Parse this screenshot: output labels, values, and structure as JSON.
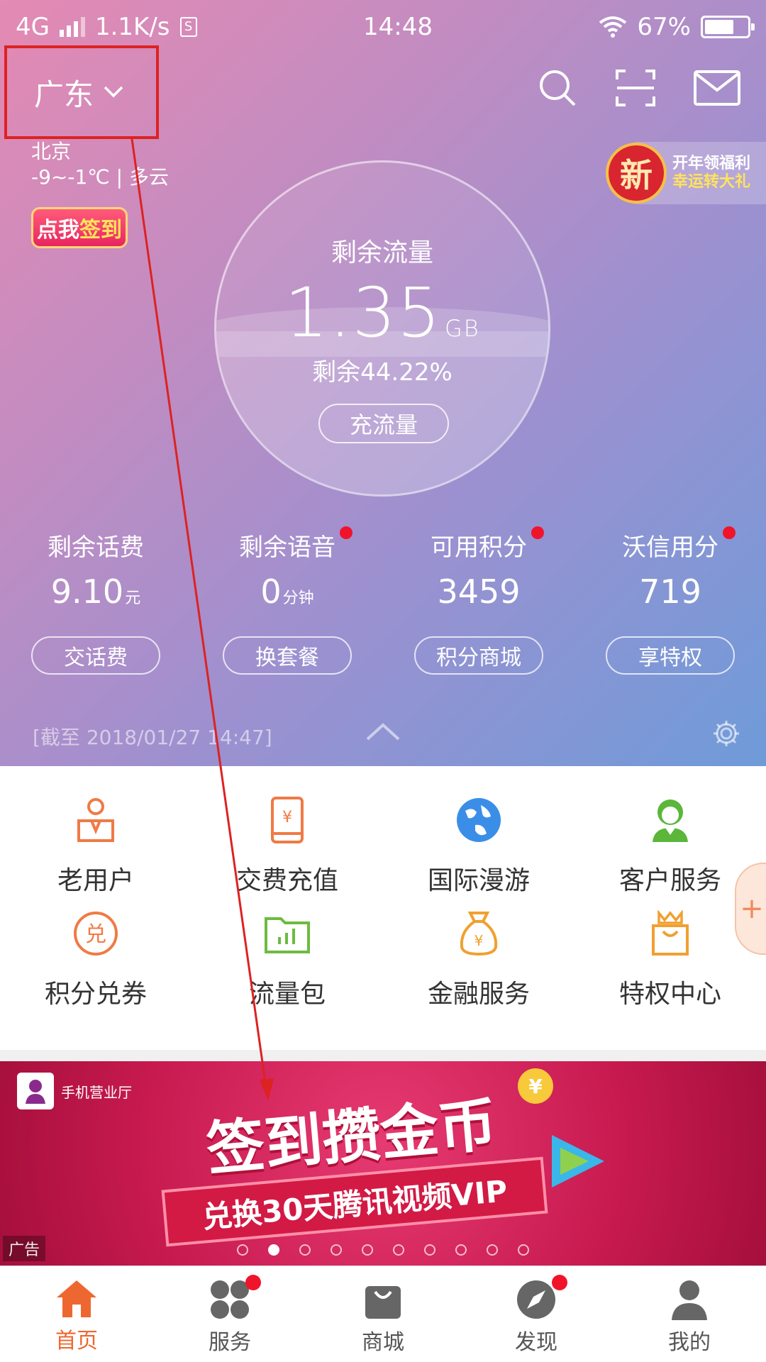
{
  "status_bar": {
    "network": "4G",
    "speed": "1.1K/s",
    "time": "14:48",
    "battery": "67%"
  },
  "header": {
    "region": "广东",
    "city": "北京",
    "weather": "-9~-1℃ | 多云",
    "signin_part1": "点我",
    "signin_part2": "签到",
    "promo_badge": "新",
    "promo_line1": "开年领福利",
    "promo_line2": "幸运转大礼"
  },
  "gauge": {
    "title": "剩余流量",
    "value": "1.35",
    "unit": "GB",
    "percent": "剩余44.22%",
    "button": "充流量"
  },
  "stats": [
    {
      "label": "剩余话费",
      "value": "9.10",
      "unit": "元",
      "button": "交话费",
      "dot": false
    },
    {
      "label": "剩余语音",
      "value": "0",
      "unit": "分钟",
      "button": "换套餐",
      "dot": true
    },
    {
      "label": "可用积分",
      "value": "3459",
      "unit": "",
      "button": "积分商城",
      "dot": true
    },
    {
      "label": "沃信用分",
      "value": "719",
      "unit": "",
      "button": "享特权",
      "dot": true
    }
  ],
  "timestamp": "[截至 2018/01/27 14:47]",
  "grid": [
    {
      "label": "老用户",
      "icon": "old-user-icon",
      "color": "#f07a45"
    },
    {
      "label": "交费充值",
      "icon": "phone-recharge-icon",
      "color": "#f07a45"
    },
    {
      "label": "国际漫游",
      "icon": "globe-icon",
      "color": "#3a8ee8"
    },
    {
      "label": "客户服务",
      "icon": "customer-service-icon",
      "color": "#5bb63a"
    },
    {
      "label": "积分兑券",
      "icon": "points-exchange-icon",
      "color": "#f07a45"
    },
    {
      "label": "流量包",
      "icon": "data-folder-icon",
      "color": "#6dbb3f"
    },
    {
      "label": "金融服务",
      "icon": "money-bag-icon",
      "color": "#f0a030"
    },
    {
      "label": "特权中心",
      "icon": "crown-bag-icon",
      "color": "#f0a030"
    }
  ],
  "banner": {
    "brand": "手机营业厅",
    "title": "签到攒金币",
    "subtitle": "兑换30天腾讯视频VIP",
    "ad_tag": "广告",
    "coin": "¥",
    "slide_count": 10,
    "active_slide": 2
  },
  "tabbar": [
    {
      "label": "首页",
      "icon": "home-icon",
      "active": true,
      "dot": false
    },
    {
      "label": "服务",
      "icon": "services-icon",
      "active": false,
      "dot": true
    },
    {
      "label": "商城",
      "icon": "shopping-bag-icon",
      "active": false,
      "dot": false
    },
    {
      "label": "发现",
      "icon": "compass-icon",
      "active": false,
      "dot": true
    },
    {
      "label": "我的",
      "icon": "profile-icon",
      "active": false,
      "dot": false
    }
  ],
  "colors": {
    "accent": "#ee6730",
    "annotation": "#dd2222",
    "notification": "#f0142b"
  }
}
